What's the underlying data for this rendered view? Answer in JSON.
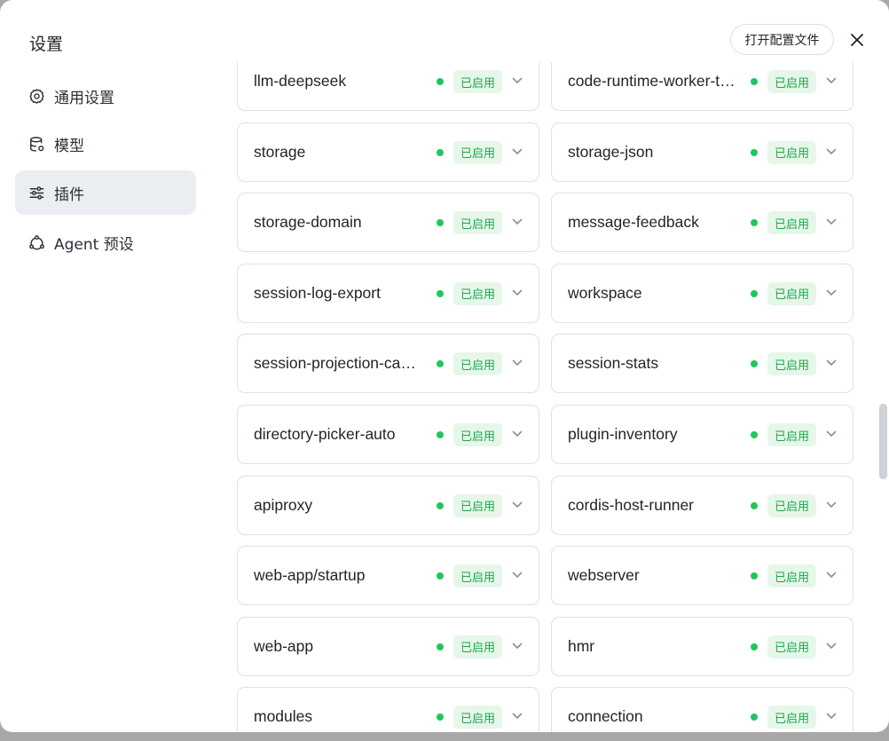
{
  "dialog": {
    "title": "设置",
    "open_config_label": "打开配置文件"
  },
  "nav": [
    {
      "label": "通用设置",
      "icon": "gear-icon"
    },
    {
      "label": "模型",
      "icon": "database-icon"
    },
    {
      "label": "插件",
      "icon": "sliders-icon",
      "active": true
    },
    {
      "label": "Agent 预设",
      "icon": "agent-cycle-icon"
    }
  ],
  "plugins": [
    {
      "name": "llm-deepseek",
      "status": "已启用"
    },
    {
      "name": "code-runtime-worker-thread",
      "status": "已启用"
    },
    {
      "name": "storage",
      "status": "已启用"
    },
    {
      "name": "storage-json",
      "status": "已启用"
    },
    {
      "name": "storage-domain",
      "status": "已启用"
    },
    {
      "name": "message-feedback",
      "status": "已启用"
    },
    {
      "name": "session-log-export",
      "status": "已启用"
    },
    {
      "name": "workspace",
      "status": "已启用"
    },
    {
      "name": "session-projection-cache",
      "status": "已启用"
    },
    {
      "name": "session-stats",
      "status": "已启用"
    },
    {
      "name": "directory-picker-auto",
      "status": "已启用"
    },
    {
      "name": "plugin-inventory",
      "status": "已启用"
    },
    {
      "name": "apiproxy",
      "status": "已启用"
    },
    {
      "name": "cordis-host-runner",
      "status": "已启用"
    },
    {
      "name": "web-app/startup",
      "status": "已启用"
    },
    {
      "name": "webserver",
      "status": "已启用"
    },
    {
      "name": "web-app",
      "status": "已启用"
    },
    {
      "name": "hmr",
      "status": "已启用"
    },
    {
      "name": "modules",
      "status": "已启用"
    },
    {
      "name": "connection",
      "status": "已启用"
    }
  ],
  "colors": {
    "enabled_dot": "#22c55e",
    "enabled_badge_bg": "#e6f7ea",
    "enabled_badge_text": "#1fa64d",
    "nav_active_bg": "#eaedf1"
  }
}
